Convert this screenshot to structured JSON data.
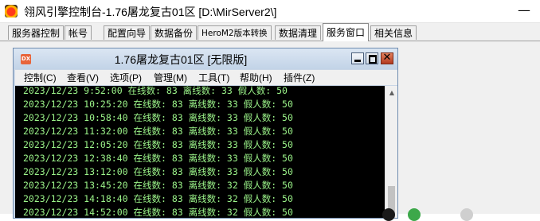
{
  "outer_window": {
    "title": "翎风引擎控制台-1.76屠龙复古01区 [D:\\MirServer2\\]",
    "minimize_glyph": "—"
  },
  "tabs": [
    {
      "label": "服务器控制",
      "active": false
    },
    {
      "label": "帐号",
      "active": false
    },
    {
      "label": "配置向导",
      "active": false
    },
    {
      "label": "数据备份",
      "active": false
    },
    {
      "label": "HeroM2版本转换",
      "active": false
    },
    {
      "label": "数据清理",
      "active": false
    },
    {
      "label": "服务窗口",
      "active": true
    },
    {
      "label": "相关信息",
      "active": false
    }
  ],
  "inner_window": {
    "icon_text": "DX",
    "title": "1.76屠龙复古01区 [无限版]",
    "close_glyph": "✕",
    "menu": [
      "控制(C)",
      "查看(V)",
      "选项(P)",
      "管理(M)",
      "工具(T)",
      "帮助(H)",
      "插件(Z)"
    ]
  },
  "log_lines": [
    "2023/12/23 9:52:00 在线数: 83 离线数: 33 假人数: 50",
    "2023/12/23 10:25:20 在线数: 83 离线数: 33 假人数: 50",
    "2023/12/23 10:58:40 在线数: 83 离线数: 33 假人数: 50",
    "2023/12/23 11:32:00 在线数: 83 离线数: 33 假人数: 50",
    "2023/12/23 12:05:20 在线数: 83 离线数: 33 假人数: 50",
    "2023/12/23 12:38:40 在线数: 83 离线数: 33 假人数: 50",
    "2023/12/23 13:12:00 在线数: 83 离线数: 33 假人数: 50",
    "2023/12/23 13:45:20 在线数: 83 离线数: 32 假人数: 50",
    "2023/12/23 14:18:40 在线数: 83 离线数: 32 假人数: 50",
    "2023/12/23 14:52:00 在线数: 83 离线数: 32 假人数: 50"
  ],
  "colors": {
    "console_bg": "#000000",
    "console_text": "#9cf58a",
    "inner_title_bg": "#c9d6e6"
  }
}
